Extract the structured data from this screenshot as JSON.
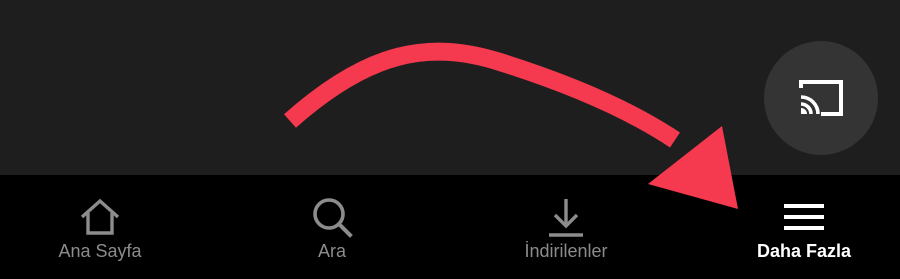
{
  "colors": {
    "content_background": "#1e1e1e",
    "nav_background": "#000000",
    "inactive": "#8c8c8c",
    "active": "#ffffff",
    "cast_button": "#343434",
    "annotation_arrow": "#f5394f"
  },
  "cast_button": {
    "icon": "cast-icon"
  },
  "bottom_nav": {
    "active_index": 3,
    "items": [
      {
        "label": "Ana Sayfa",
        "icon": "home-icon"
      },
      {
        "label": "Ara",
        "icon": "search-icon"
      },
      {
        "label": "İndirilenler",
        "icon": "download-icon"
      },
      {
        "label": "Daha Fazla",
        "icon": "menu-icon"
      }
    ]
  },
  "annotation": {
    "type": "curved-arrow",
    "points_to": "Daha Fazla"
  }
}
